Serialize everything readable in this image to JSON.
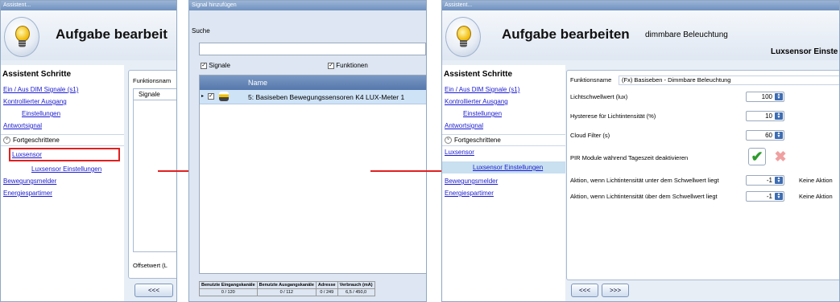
{
  "left": {
    "title": "Assistent...",
    "heading": "Aufgabe bearbeit",
    "steps_title": "Assistent Schritte",
    "steps": [
      "Ein / Aus DIM Signale (s1)",
      "Kontrollierter Ausgang",
      "Einstellungen",
      "Antwortsignal"
    ],
    "advanced": "Fortgeschrittene",
    "advanced_items": [
      "Luxsensor",
      "Luxsensor Einstellungen",
      "Bewegungsmelder",
      "Energiespartimer"
    ],
    "funktionsname_label": "Funktionsnam",
    "tab_signale": "Signale",
    "offset_label": "Offsetwert (L",
    "back_button": "<<<"
  },
  "middle": {
    "title": "Signal hinzufügen",
    "search_label": "Suche",
    "search_value": "",
    "chk_signale": "Signale",
    "chk_funktionen": "Funktionen",
    "col_name": "Name",
    "row_name": "5: Basiseben Bewegungssensoren K4 LUX-Meter 1",
    "stats_headers": [
      "Benutzte Eingangskanäle",
      "Benutzte Ausgangskanäle",
      "Adresse",
      "Verbrauch (mA)"
    ],
    "stats_values": [
      "0 / 120",
      "0 / 112",
      "0 / 249",
      "6,5 / 450,0"
    ]
  },
  "right": {
    "title": "Assistent...",
    "heading": "Aufgabe bearbeiten",
    "subheading": "dimmbare Beleuchtung",
    "section_title": "Luxsensor Einste",
    "steps_title": "Assistent Schritte",
    "steps": [
      "Ein / Aus DIM Signale (s1)",
      "Kontrollierter Ausgang",
      "Einstellungen",
      "Antwortsignal"
    ],
    "advanced": "Fortgeschrittene",
    "advanced_items": [
      "Luxsensor",
      "Luxsensor Einstellungen",
      "Bewegungsmelder",
      "Energiespartimer"
    ],
    "funktionsname_label": "Funktionsname",
    "funktionsname_value": "(Fx) Basiseben - Dimmbare Beleuchtung",
    "fields": [
      {
        "label": "Lichtschwellwert (lux)",
        "value": "100"
      },
      {
        "label": "Hysterese für Lichtintensität (%)",
        "value": "10"
      },
      {
        "label": "Cloud Filter (s)",
        "value": "60"
      }
    ],
    "pir_label": "PIR Module während Tageszeit deaktivieren",
    "action_below_label": "Aktion, wenn Lichtintensität unter dem Schwellwert liegt",
    "action_below_value": "-1",
    "action_below_text": "Keine Aktion",
    "action_above_label": "Aktion, wenn Lichtintensität über dem Schwellwert liegt",
    "action_above_value": "-1",
    "action_above_text": "Keine Aktion",
    "back_button": "<<<",
    "next_button": ">>>"
  },
  "colors": {
    "highlight": "#e02020",
    "accent": "#3d6db3"
  }
}
